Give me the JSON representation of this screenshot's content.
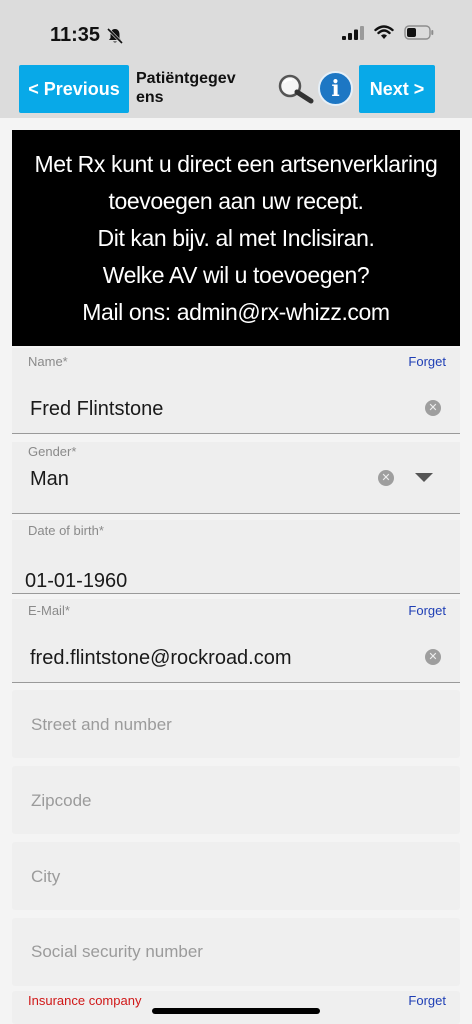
{
  "status_bar": {
    "time": "11:35",
    "icons": [
      "bell-slash-icon",
      "cellular-signal-icon",
      "wifi-icon",
      "battery-icon"
    ]
  },
  "header": {
    "previous_label": "< Previous",
    "title": "Patiëntgegevens",
    "next_label": "Next >",
    "info_glyph": "i",
    "accent_color": "#08a9e8"
  },
  "banner": {
    "lines": [
      "Met Rx kunt u direct een artsenverklaring",
      "toevoegen aan uw recept.",
      "Dit kan bijv. al met Inclisiran.",
      "Welke AV wil u toevoegen?",
      "Mail ons: admin@rx-whizz.com"
    ]
  },
  "form": {
    "name": {
      "label": "Name*",
      "value": "Fred Flintstone",
      "forget": "Forget"
    },
    "gender": {
      "label": "Gender*",
      "value": "Man"
    },
    "dob": {
      "label": "Date of birth*",
      "value": "01-01-1960"
    },
    "email": {
      "label": "E-Mail*",
      "value": "fred.flintstone@rockroad.com",
      "forget": "Forget"
    },
    "street": {
      "placeholder": "Street and number"
    },
    "zipcode": {
      "placeholder": "Zipcode"
    },
    "city": {
      "placeholder": "City"
    },
    "ssn": {
      "placeholder": "Social security number"
    },
    "insurance": {
      "label": "Insurance company",
      "forget": "Forget"
    }
  }
}
